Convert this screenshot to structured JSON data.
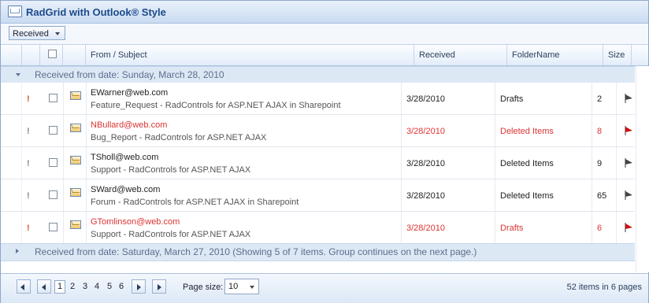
{
  "title": "RadGrid with Outlook® Style",
  "group_panel": {
    "group_button": "Received"
  },
  "columns": {
    "from_subject": "From / Subject",
    "received": "Received",
    "folder": "FolderName",
    "size": "Size"
  },
  "groups": [
    {
      "header": "Received from date: Sunday, March 28, 2010",
      "expanded": true
    },
    {
      "header": "Received from date: Saturday, March 27, 2010 (Showing 5 of 7 items. Group continues on the next page.)",
      "expanded": false
    }
  ],
  "rows": [
    {
      "priority": "!",
      "priority_color": "#d9582b",
      "from": "EWarner@web.com",
      "subject": "Feature_Request - RadControls for ASP.NET AJAX in Sharepoint",
      "received": "3/28/2010",
      "folder": "Drafts",
      "size": "2",
      "highlight": false,
      "flag_color": "#444444"
    },
    {
      "priority": "!",
      "priority_color": "#888888",
      "from": "NBullard@web.com",
      "subject": "Bug_Report - RadControls for ASP.NET AJAX",
      "received": "3/28/2010",
      "folder": "Deleted Items",
      "size": "8",
      "highlight": true,
      "flag_color": "#cc1111"
    },
    {
      "priority": "!",
      "priority_color": "#888888",
      "from": "TSholl@web.com",
      "subject": "Support - RadControls for ASP.NET AJAX",
      "received": "3/28/2010",
      "folder": "Deleted Items",
      "size": "9",
      "highlight": false,
      "flag_color": "#444444"
    },
    {
      "priority": "!",
      "priority_color": "#888888",
      "from": "SWard@web.com",
      "subject": "Forum - RadControls for ASP.NET AJAX in Sharepoint",
      "received": "3/28/2010",
      "folder": "Deleted Items",
      "size": "65",
      "highlight": false,
      "flag_color": "#444444"
    },
    {
      "priority": "!",
      "priority_color": "#d9582b",
      "from": "GTomlinson@web.com",
      "subject": "Support - RadControls for ASP.NET AJAX",
      "received": "3/28/2010",
      "folder": "Drafts",
      "size": "6",
      "highlight": true,
      "flag_color": "#cc1111"
    }
  ],
  "pager": {
    "pages": [
      "1",
      "2",
      "3",
      "4",
      "5",
      "6"
    ],
    "current_page": "1",
    "page_size_label": "Page size:",
    "page_size": "10",
    "info": "52 items in 6 pages"
  },
  "colors": {
    "accent": "#1d4a8a",
    "highlight_text": "#dd3333",
    "group_row_bg": "#dde8f5"
  }
}
